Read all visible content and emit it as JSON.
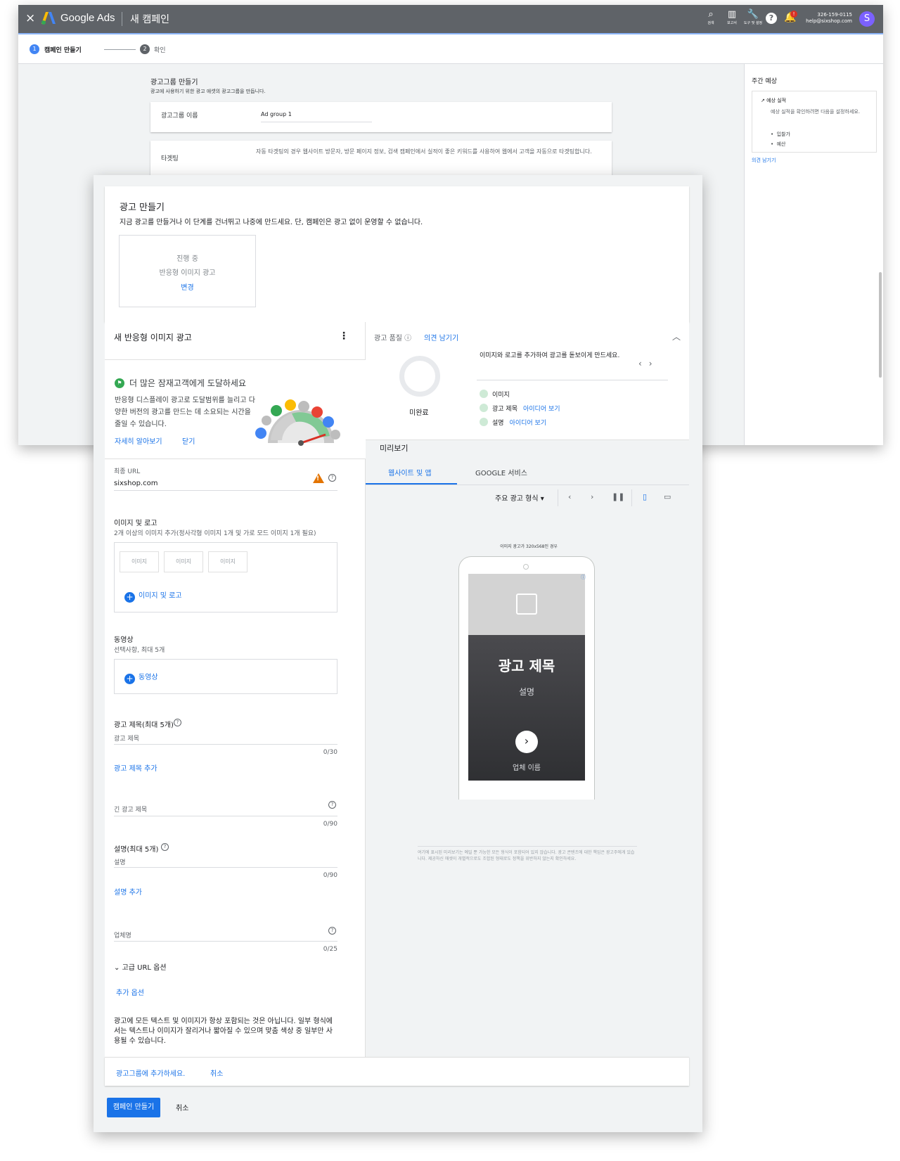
{
  "topbar": {
    "close": "×",
    "brand": "Google Ads",
    "campaign": "새 캠페인",
    "icons": [
      {
        "name": "search-icon",
        "glyph": "⌕",
        "label": "검색"
      },
      {
        "name": "reports-icon",
        "glyph": "▥",
        "label": "보고서"
      },
      {
        "name": "tools-icon",
        "glyph": "🔧",
        "label": "도구 및 설정"
      }
    ],
    "help": "?",
    "notification_badge": "!",
    "account_id": "326-159-0115",
    "account_email": "help@sixshop.com",
    "avatar": "S"
  },
  "steps": [
    {
      "num": "1",
      "label": "캠페인 만들기",
      "color": "#4285f4"
    },
    {
      "num": "2",
      "label": "확인",
      "color": "#5f6368"
    }
  ],
  "adgroup": {
    "title": "광고그룹 만들기",
    "subtitle": "광고에 사용하기 위한 광고 애셋의 광고그룹을 만듭니다.",
    "name_label": "광고그룹 이름",
    "name_value": "Ad group 1",
    "targeting_label": "타겟팅",
    "targeting_text": "자동 타겟팅의 경우 웹사이트 방문자, 방문 페이지 정보, 검색 캠페인에서 실적이 좋은 키워드를 사용하여 웹에서 고객을 자동으로 타겟팅합니다."
  },
  "weekly": {
    "title": "주간 예상",
    "perf": "예상 실적",
    "desc": "예상 실적을 확인하려면 다음을 설정하세요.",
    "items": [
      "입찰가",
      "예산"
    ],
    "feedback": "의견 남기기"
  },
  "ad_create": {
    "title": "광고 만들기",
    "subtitle": "지금 광고를 만들거나 이 단계를 건너뛰고 나중에 만드세요. 단, 캠페인은 광고 없이 운영할 수 없습니다.",
    "status": "진행 중",
    "type": "반응형 이미지 광고",
    "change": "변경"
  },
  "editor": {
    "title": "새 반응형 이미지 광고",
    "menu": "⋮",
    "promo": {
      "flag": "⚑",
      "heading": "더 많은 잠재고객에게 도달하세요",
      "body": "반응형 디스플레이 광고로 도달범위를 늘리고 다양한 버전의 광고를 만드는 데 소요되는 시간을 줄일 수 있습니다.",
      "learn_more": "자세히 알아보기",
      "close": "닫기"
    },
    "final_url_label": "최종 URL",
    "final_url": "sixshop.com",
    "images_label": "이미지 및 로고",
    "images_hint": "2개 이상의 이미지 추가(정사각형 이미지 1개 및 가로 모드 이미지 1개 필요)",
    "image_slots": [
      "이미지",
      "이미지",
      "이미지"
    ],
    "add_images": "이미지 및 로고",
    "video_label": "동영상",
    "video_hint": "선택사항, 최대 5개",
    "add_video": "동영상",
    "headline_label": "광고 제목(최대 5개)",
    "headline_placeholder": "광고 제목",
    "headline_count": "0/30",
    "add_headline": "광고 제목 추가",
    "long_headline_placeholder": "긴 광고 제목",
    "long_headline_count": "0/90",
    "desc_label": "설명(최대 5개)",
    "desc_placeholder": "설명",
    "desc_count": "0/90",
    "add_desc": "설명 추가",
    "business_placeholder": "업체명",
    "business_count": "0/25",
    "advanced_url": "고급 URL 옵션",
    "more_options": "추가 옵션",
    "note": "광고에 모든 텍스트 및 이미지가 항상 포함되는 것은 아닙니다. 일부 형식에서는 텍스트나 이미지가 잘리거나 짧아질 수 있으며 맞춤 색상 중 일부만 사용될 수 있습니다."
  },
  "quality": {
    "title": "광고 품질",
    "feedback": "의견 남기기",
    "status": "미완료",
    "tip": "이미지와 로고를 추가하여 광고를 돋보이게 만드세요.",
    "items": [
      {
        "label": "이미지",
        "link": ""
      },
      {
        "label": "광고 제목",
        "link": "아이디어 보기"
      },
      {
        "label": "설명",
        "link": "아이디어 보기"
      }
    ]
  },
  "preview": {
    "title": "미리보기",
    "tabs": [
      "웹사이트 및 앱",
      "GOOGLE 서비스"
    ],
    "format": "주요 광고 형식 ▾",
    "caption": "이미지 광고가 320x568인 경우",
    "ad_title": "광고 제목",
    "ad_desc": "설명",
    "ad_business": "업체 이름",
    "ad_marker": "ⓘ",
    "disclaimer": "여기에 표시된 미리보기는 예일 뿐 가능한 모든 형식이 포함되어 있지 않습니다. 광고 콘텐츠에 대한 책임은 광고주에게 있습니다. 제공하신 애셋이 개별적으로도 조합된 형태로도 정책을 위반하지 않는지 확인하세요."
  },
  "actions": {
    "add_to_group": "광고그룹에 추가하세요.",
    "cancel": "취소",
    "create_campaign": "캠페인 만들기",
    "cancel2": "취소"
  }
}
